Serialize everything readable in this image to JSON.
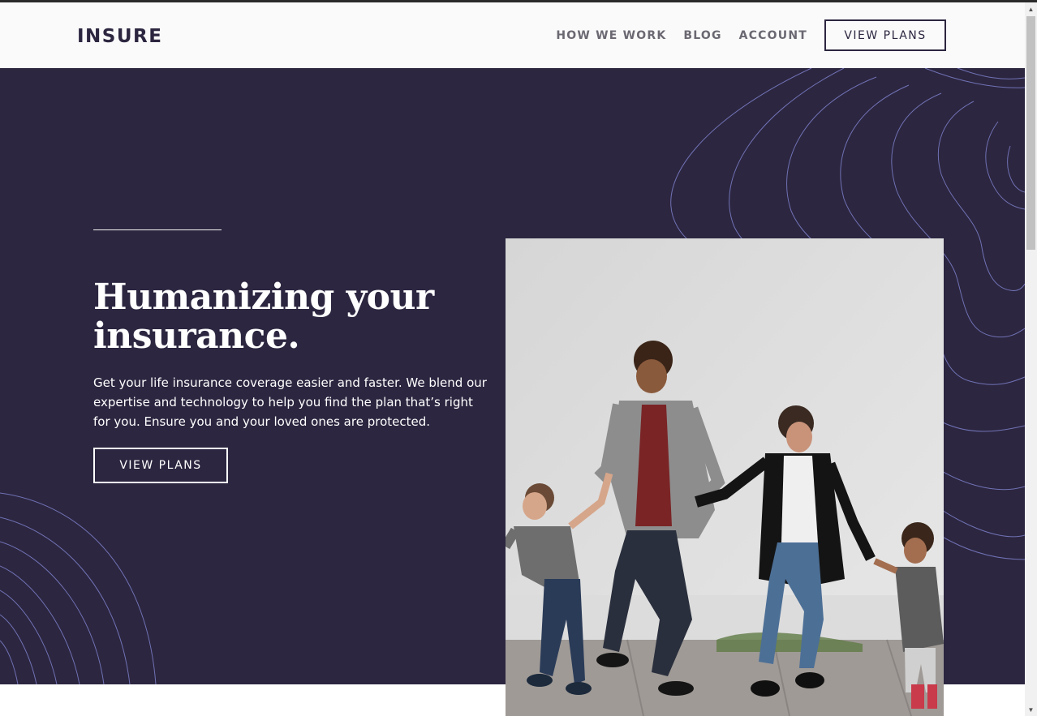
{
  "header": {
    "logo": "INSURE",
    "nav": [
      "HOW WE WORK",
      "BLOG",
      "ACCOUNT"
    ],
    "cta": "VIEW PLANS"
  },
  "hero": {
    "title": "Humanizing your insurance.",
    "text": "Get your life insurance coverage easier and faster. We blend our expertise and technology to help you find the plan that’s right for you. Ensure you and your loved ones are protected.",
    "cta": "VIEW PLANS"
  },
  "colors": {
    "brand_dark": "#2c2640",
    "header_bg": "#fafafa",
    "contour_line": "#6a6fc4"
  },
  "icons": {
    "scroll_up": "triangle-up",
    "scroll_down": "triangle-down"
  }
}
